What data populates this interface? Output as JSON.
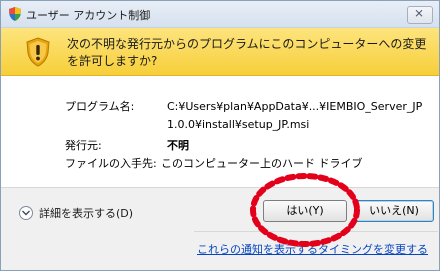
{
  "window": {
    "title": "ユーザー アカウント制御",
    "close_glyph": "⨯"
  },
  "header": {
    "question": "次の不明な発行元からのプログラムにこのコンピューターへの変更を許可しますか?"
  },
  "details_info": {
    "program_label": "プログラム名:",
    "program_value_line1": "C:¥Users¥plan¥AppData¥...¥IEMBIO_Server_JP",
    "program_value_line2": "1.0.0¥install¥setup_JP.msi",
    "publisher_label": "発行元:",
    "publisher_value": "不明",
    "origin_label": "ファイルの入手先:",
    "origin_value": "このコンピューター上のハード ドライブ"
  },
  "footer": {
    "show_details": "詳細を表示する(D)",
    "yes_button": "はい(Y)",
    "no_button": "いいえ(N)",
    "notification_link": "これらの通知を表示するタイミングを変更する"
  },
  "colors": {
    "header_yellow": "#f7cf3a",
    "annotation_red": "#e3001b",
    "link_blue": "#0645c0"
  },
  "icons": [
    "shield-icon",
    "uac-warning-shield-icon",
    "chevron-down-icon",
    "close-icon"
  ]
}
